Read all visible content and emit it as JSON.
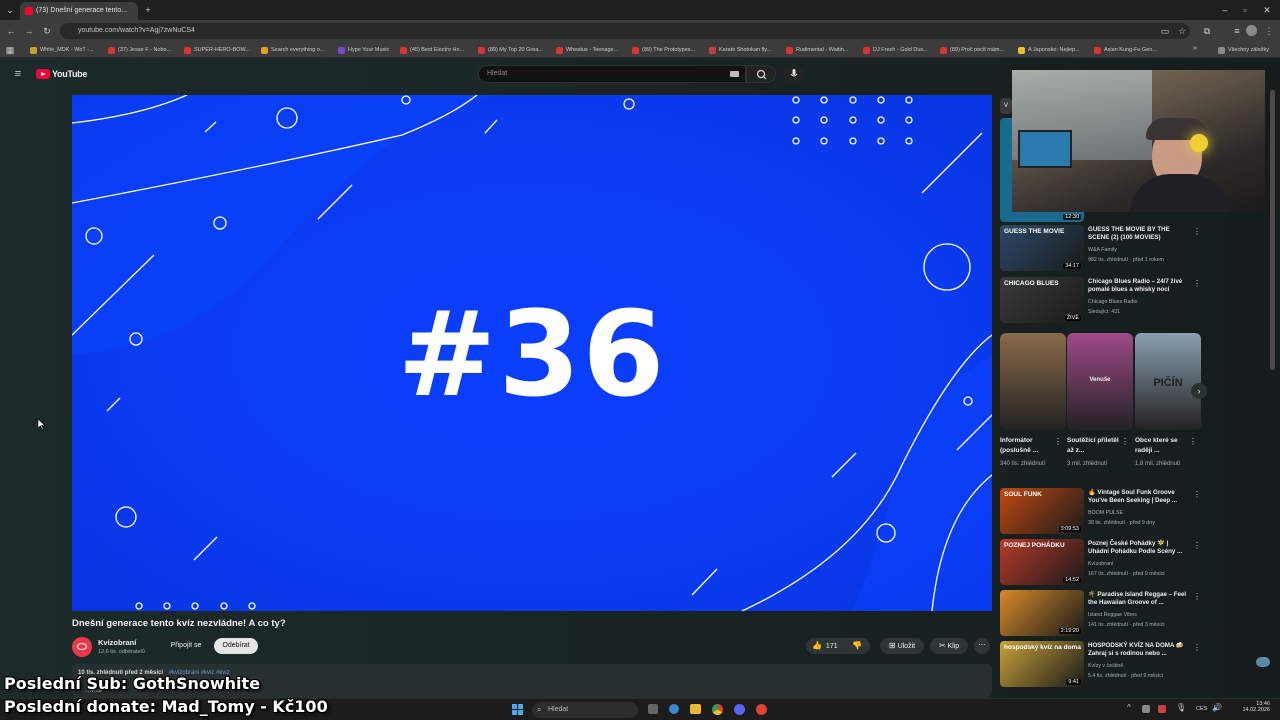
{
  "browser": {
    "tab_title": "(73) Dnešní generace tento...",
    "url": "youtube.com/watch?v=Agj7zwNuCS4",
    "bookmarks": [
      "White_MDK - WoT -...",
      "(37) Jesse F - Nobo...",
      "SUPER-HERO-BOW...",
      "Search everything o...",
      "Hype Your Music",
      "(45) Best Electro Ho...",
      "(89) My Top 20 Grea...",
      "Wheatus - Teenage...",
      "(89) The Prototypes...",
      "Karate Shotokan fly...",
      "Rudimental - Waitin...",
      "DJ Fresh - Gold Dus...",
      "(89) Proč pocit mám...",
      "A Japonsko: Nejlep...",
      "Asian Kung-Fu Gen..."
    ],
    "all_bookmarks": "Všechny záložky"
  },
  "youtube": {
    "logo": "YouTube",
    "search_placeholder": "Hledat"
  },
  "video": {
    "episode": "#36",
    "title": "Dnešní generace tento kvíz nezvládne! A co ty?",
    "channel": "Kvízobraní",
    "subscribers": "12,6 tis. odběratelů",
    "join": "Připojit se",
    "subscribe": "Odebírat",
    "likes": "171",
    "save": "Uložit",
    "clip": "Klip",
    "views_line": "10 tis. zhlédnutí  před 2 měsíci",
    "tags": "#kvizobrani #kviz #kviz",
    "more": "...více"
  },
  "sidebar": {
    "top_duration": "12:30",
    "videos": [
      {
        "title": "GUESS THE MOVIE BY THE SCENE (2) (100 MOVIES)",
        "channel": "W&A Family",
        "meta": "982 tis. zhlédnutí · před 1 rokem",
        "duration": "34:17",
        "thumb_text": "GUESS THE MOVIE",
        "thumb_color": "#2b4a6a"
      },
      {
        "title": "Chicago Blues Radio – 24/7 živé pomalé blues a whisky noci",
        "channel": "Chicago Blues Radio",
        "meta": "Sledující: 431",
        "duration": "ŽIVĚ",
        "thumb_text": "CHICAGO BLUES",
        "thumb_color": "#3a3a3a"
      },
      {
        "title": "🔥 Vintage Soul Funk Groove You've Been Seeking | Deep ...",
        "channel": "BOOM PULSE",
        "meta": "38 tis. zhlédnutí · před 9 dny",
        "duration": "3:09:53",
        "thumb_text": "SOUL FUNK",
        "thumb_color": "#c24a12"
      },
      {
        "title": "Poznej České Pohádky 🧚 | Uhádni Pohádku Podle Scény ...",
        "channel": "Kvízobraní",
        "meta": "167 tis. zhlédnutí · před 9 měsíci",
        "duration": "14:52",
        "thumb_text": "POZNEJ POHÁDKU",
        "thumb_color": "#b83a2a"
      },
      {
        "title": "🌴 Paradise Island Reggae – Feel the Hawaiian Groove of ...",
        "channel": "Island Reggae Vibes",
        "meta": "141 tis. zhlédnutí · před 3 měsíci",
        "duration": "2:19:20",
        "thumb_text": "",
        "thumb_color": "#d88a2a"
      },
      {
        "title": "HOSPODSKÝ KVÍZ NA DOMA 🍻 Zahraj si s rodinou nebo ...",
        "channel": "Kvízy v češtině",
        "meta": "5,4 tis. zhlédnutí · před 9 měsíci",
        "duration": "9:41",
        "thumb_text": "hospodský kvíz na doma",
        "thumb_color": "#c9a23a"
      }
    ],
    "shorts": [
      {
        "title": "Informátor (poslušně ...",
        "meta": "340 tis. zhlédnutí",
        "color": "#8a6a4a",
        "overlay": ""
      },
      {
        "title": "Soutěžící přiletěl až z...",
        "meta": "3 mil. zhlédnutí",
        "color": "#a04a8a",
        "overlay": "Venuše"
      },
      {
        "title": "Obce které se raději ...",
        "meta": "1,8 mil. zhlédnutí",
        "color": "#8aa0b0",
        "overlay": "PIČÍN"
      }
    ]
  },
  "overlay": {
    "sub": "Poslední Sub: GothSnowhite",
    "donate": "Poslední donate: Mad_Tomy - Kč100"
  },
  "taskbar": {
    "search": "Hledat",
    "lang": "CES",
    "time": "13:46",
    "date": "14.02.2026"
  }
}
